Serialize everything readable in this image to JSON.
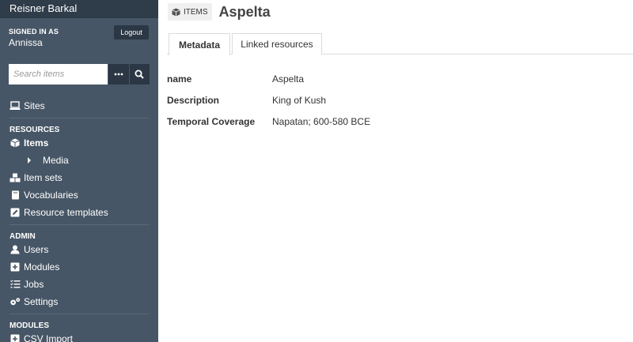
{
  "sidebar": {
    "site_title": "Reisner Barkal",
    "signed_in_label": "SIGNED IN AS",
    "user_name": "Annissa",
    "logout_label": "Logout",
    "search_placeholder": "Search items",
    "nav": {
      "sites": "Sites",
      "resources_label": "RESOURCES",
      "items": "Items",
      "media": "Media",
      "item_sets": "Item sets",
      "vocabularies": "Vocabularies",
      "resource_templates": "Resource templates",
      "admin_label": "ADMIN",
      "users": "Users",
      "modules": "Modules",
      "jobs": "Jobs",
      "settings": "Settings",
      "modules_label": "MODULES",
      "csv_import": "CSV Import"
    }
  },
  "header": {
    "badge_label": "ITEMS",
    "title": "Aspelta"
  },
  "tabs": {
    "metadata": "Metadata",
    "linked": "Linked resources"
  },
  "properties": [
    {
      "label": "name",
      "value": "Aspelta"
    },
    {
      "label": "Description",
      "value": "King of Kush"
    },
    {
      "label": "Temporal Coverage",
      "value": "Napatan; 600-580 BCE"
    }
  ],
  "colors": {
    "sidebar_bg": "#475666",
    "sidebar_header_bg": "#2f3c49",
    "button_dark": "#2b3744"
  }
}
